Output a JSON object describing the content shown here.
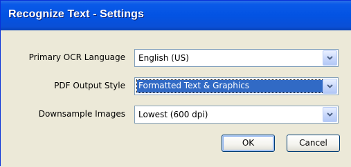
{
  "window": {
    "title": "Recognize Text - Settings"
  },
  "fields": [
    {
      "label": "Primary OCR Language",
      "value": "English (US)",
      "icon": "chevron-down-icon"
    },
    {
      "label": "PDF Output Style",
      "value": "Formatted Text & Graphics",
      "icon": "chevron-down-icon",
      "focused": true
    },
    {
      "label": "Downsample Images",
      "value": "Lowest (600 dpi)",
      "icon": "chevron-down-icon"
    }
  ],
  "buttons": {
    "ok_label": "OK",
    "cancel_label": "Cancel"
  },
  "colors": {
    "titlebar": "#0353e3",
    "selection": "#316ac5",
    "dialog_background": "#ece9d8"
  }
}
